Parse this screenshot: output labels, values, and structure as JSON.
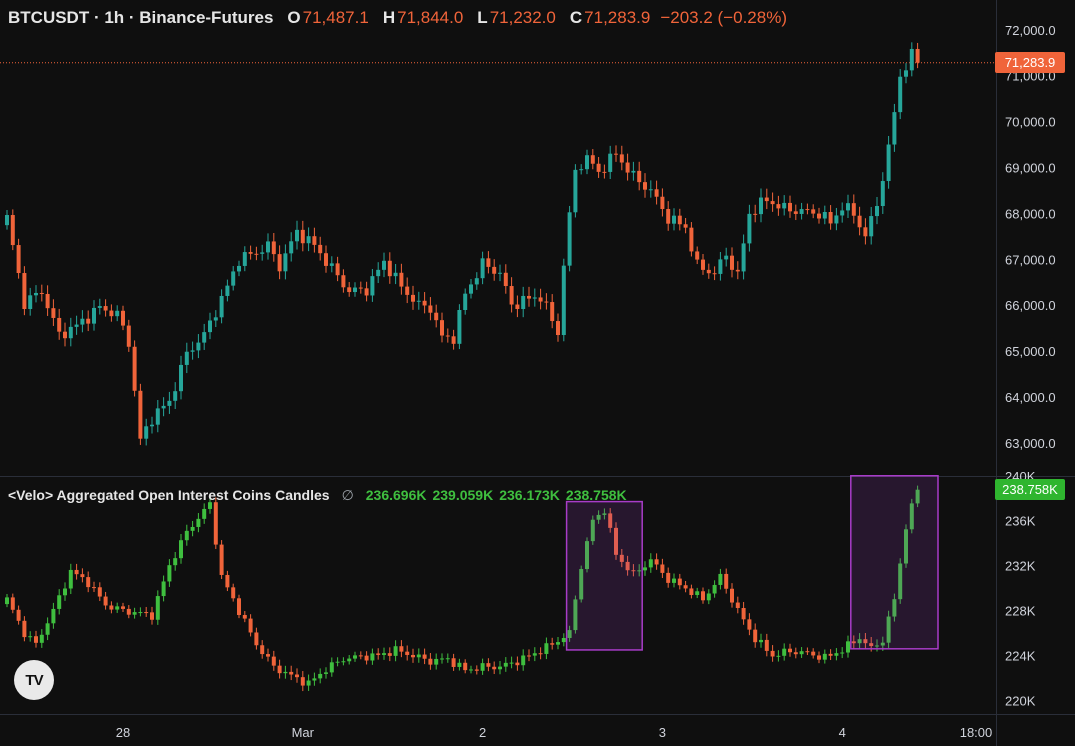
{
  "header": {
    "symbol": "BTCUSDT · 1h · Binance-Futures",
    "open_label": "O",
    "open": "71,487.1",
    "high_label": "H",
    "high": "71,844.0",
    "low_label": "L",
    "low": "71,232.0",
    "close_label": "C",
    "close": "71,283.9",
    "change": "−203.2 (−0.28%)"
  },
  "indicator": {
    "name": "<Velo> Aggregated Open Interest Coins Candles",
    "null_symbol": "∅",
    "v1": "236.696K",
    "v2": "239.059K",
    "v3": "236.173K",
    "v4": "238.758K"
  },
  "price_tag": "71,283.9",
  "oi_tag": "238.758K",
  "logo_text": "TV",
  "colors": {
    "up": "#26a69a",
    "down": "#f0643a",
    "oi_up": "#3fbf3f",
    "oi_down": "#f0643a",
    "highlight": "#a83cc8",
    "price_line": "#f0643a"
  },
  "chart_data": [
    {
      "type": "candlestick",
      "title": "BTCUSDT · 1h · Binance-Futures",
      "ylim": [
        62300,
        72650
      ],
      "y_ticks": [
        "72,000.0",
        "71,000.0",
        "70,000.0",
        "69,000.0",
        "68,000.0",
        "67,000.0",
        "66,000.0",
        "65,000.0",
        "64,000.0",
        "63,000.0"
      ],
      "x_ticks": [
        "28",
        "Mar",
        "2",
        "3",
        "4",
        "18:00"
      ],
      "anchors": [
        [
          0,
          67900
        ],
        [
          3,
          66050
        ],
        [
          6,
          66300
        ],
        [
          9,
          65350
        ],
        [
          12,
          65550
        ],
        [
          16,
          65950
        ],
        [
          19,
          65800
        ],
        [
          21,
          65200
        ],
        [
          23,
          63050
        ],
        [
          25,
          63550
        ],
        [
          28,
          63900
        ],
        [
          31,
          64950
        ],
        [
          34,
          65350
        ],
        [
          38,
          66400
        ],
        [
          40,
          67000
        ],
        [
          43,
          67150
        ],
        [
          45,
          67300
        ],
        [
          47,
          66850
        ],
        [
          50,
          67600
        ],
        [
          53,
          67300
        ],
        [
          56,
          66800
        ],
        [
          59,
          66300
        ],
        [
          62,
          66350
        ],
        [
          65,
          66950
        ],
        [
          68,
          66400
        ],
        [
          71,
          66000
        ],
        [
          73,
          65950
        ],
        [
          75,
          65300
        ],
        [
          77,
          65300
        ],
        [
          79,
          66250
        ],
        [
          82,
          66900
        ],
        [
          85,
          66700
        ],
        [
          87,
          66000
        ],
        [
          89,
          66100
        ],
        [
          92,
          66200
        ],
        [
          95,
          65400
        ],
        [
          96,
          66900
        ],
        [
          98,
          68950
        ],
        [
          100,
          69200
        ],
        [
          102,
          68900
        ],
        [
          105,
          69300
        ],
        [
          108,
          68800
        ],
        [
          111,
          68500
        ],
        [
          114,
          67900
        ],
        [
          117,
          67700
        ],
        [
          119,
          66850
        ],
        [
          122,
          66700
        ],
        [
          124,
          67100
        ],
        [
          126,
          66650
        ],
        [
          128,
          68000
        ],
        [
          131,
          68300
        ],
        [
          134,
          68100
        ],
        [
          137,
          68050
        ],
        [
          140,
          68000
        ],
        [
          142,
          67800
        ],
        [
          144,
          68150
        ],
        [
          146,
          68000
        ],
        [
          148,
          67500
        ],
        [
          150,
          68200
        ],
        [
          152,
          69400
        ],
        [
          154,
          71000
        ],
        [
          156,
          71430
        ],
        [
          157,
          71284
        ]
      ]
    },
    {
      "type": "candlestick",
      "title": "<Velo> Aggregated Open Interest Coins Candles",
      "ylim": [
        218800,
        239800
      ],
      "y_ticks": [
        "240K",
        "236K",
        "232K",
        "228K",
        "224K",
        "220K"
      ],
      "anchors": [
        [
          0,
          229000
        ],
        [
          3,
          226000
        ],
        [
          5,
          225000
        ],
        [
          8,
          228000
        ],
        [
          11,
          231500
        ],
        [
          14,
          230500
        ],
        [
          17,
          228500
        ],
        [
          20,
          228000
        ],
        [
          25,
          227600
        ],
        [
          28,
          232000
        ],
        [
          31,
          235000
        ],
        [
          35,
          237500
        ],
        [
          37,
          231000
        ],
        [
          40,
          228000
        ],
        [
          43,
          225000
        ],
        [
          46,
          223000
        ],
        [
          49,
          222200
        ],
        [
          52,
          221500
        ],
        [
          55,
          222800
        ],
        [
          58,
          223700
        ],
        [
          61,
          223900
        ],
        [
          64,
          224000
        ],
        [
          67,
          224500
        ],
        [
          70,
          224000
        ],
        [
          73,
          223500
        ],
        [
          76,
          223700
        ],
        [
          79,
          222700
        ],
        [
          82,
          223000
        ],
        [
          85,
          223000
        ],
        [
          88,
          223500
        ],
        [
          91,
          224200
        ],
        [
          94,
          225000
        ],
        [
          97,
          226000
        ],
        [
          99,
          232000
        ],
        [
          101,
          236000
        ],
        [
          103,
          237000
        ],
        [
          105,
          233000
        ],
        [
          108,
          231200
        ],
        [
          111,
          232500
        ],
        [
          114,
          230800
        ],
        [
          117,
          230000
        ],
        [
          120,
          229000
        ],
        [
          123,
          231000
        ],
        [
          126,
          228000
        ],
        [
          129,
          225500
        ],
        [
          132,
          224000
        ],
        [
          135,
          224400
        ],
        [
          138,
          224200
        ],
        [
          141,
          223800
        ],
        [
          144,
          224500
        ],
        [
          147,
          225600
        ],
        [
          149,
          224600
        ],
        [
          151,
          225400
        ],
        [
          153,
          229000
        ],
        [
          155,
          235500
        ],
        [
          157,
          238758
        ]
      ],
      "highlights": [
        {
          "from_index": 97,
          "to_index": 109,
          "low": 224500,
          "high": 237700
        },
        {
          "from_index": 146,
          "to_index": 160,
          "low": 224600,
          "high": 240000
        }
      ]
    }
  ]
}
